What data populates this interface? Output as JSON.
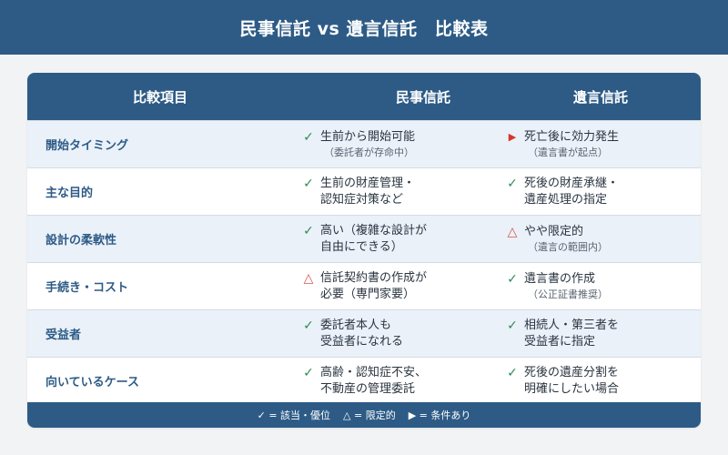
{
  "title": "民事信託 vs 遺言信託　比較表",
  "headers": [
    "比較項目",
    "民事信託",
    "遺言信託"
  ],
  "rows": [
    {
      "label": "開始タイミング",
      "a": {
        "mark": "✓",
        "type": "ok",
        "text": "生前から開始可能",
        "sub": "（委託者が存命中）"
      },
      "b": {
        "mark": "▶",
        "type": "cond",
        "text": "死亡後に効力発生",
        "sub": "（遺言書が起点）"
      }
    },
    {
      "label": "主な目的",
      "a": {
        "mark": "✓",
        "type": "ok",
        "text": "生前の財産管理・\n認知症対策など",
        "sub": ""
      },
      "b": {
        "mark": "✓",
        "type": "ok",
        "text": "死後の財産承継・\n遺産処理の指定",
        "sub": ""
      }
    },
    {
      "label": "設計の柔軟性",
      "a": {
        "mark": "✓",
        "type": "ok",
        "text": "高い（複雑な設計が\n自由にできる）",
        "sub": ""
      },
      "b": {
        "mark": "△",
        "type": "warn",
        "text": "やや限定的",
        "sub": "（遺言の範囲内）"
      }
    },
    {
      "label": "手続き・コスト",
      "a": {
        "mark": "△",
        "type": "warn",
        "text": "信託契約書の作成が\n必要（専門家要）",
        "sub": ""
      },
      "b": {
        "mark": "✓",
        "type": "ok",
        "text": "遺言書の作成",
        "sub": "（公正証書推奨）"
      }
    },
    {
      "label": "受益者",
      "a": {
        "mark": "✓",
        "type": "ok",
        "text": "委託者本人も\n受益者になれる",
        "sub": ""
      },
      "b": {
        "mark": "✓",
        "type": "ok",
        "text": "相続人・第三者を\n受益者に指定",
        "sub": ""
      }
    },
    {
      "label": "向いているケース",
      "a": {
        "mark": "✓",
        "type": "ok",
        "text": "高齢・認知症不安、\n不動産の管理委託",
        "sub": ""
      },
      "b": {
        "mark": "✓",
        "type": "ok",
        "text": "死後の遺産分割を\n明確にしたい場合",
        "sub": ""
      }
    }
  ],
  "legend": [
    "✓ = 該当・優位",
    "△ = 限定的",
    "▶ = 条件あり"
  ],
  "colors": {
    "primary": "#2d5b86",
    "alt_row": "#eaf1f9",
    "ok": "#2e8b57",
    "warn": "#d9534f",
    "cond": "#d9342b"
  }
}
